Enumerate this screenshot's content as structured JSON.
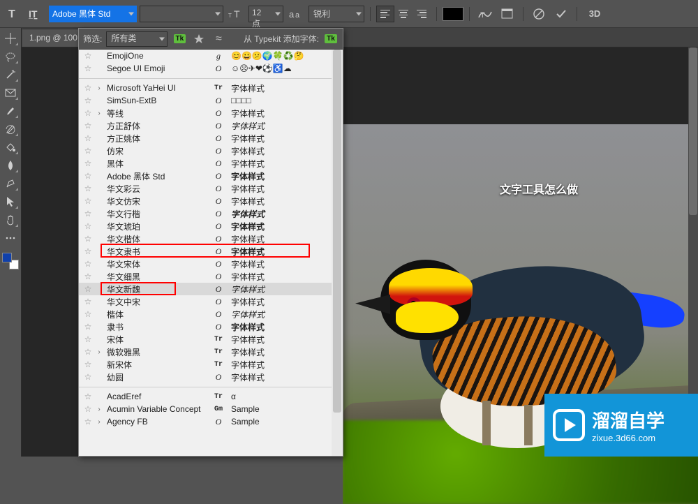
{
  "options": {
    "font_family": "Adobe 黑体 Std",
    "font_weight": "",
    "size_value": "12 点",
    "aa_mode": "锐利"
  },
  "tab": {
    "label": "1.png @ 100"
  },
  "panel": {
    "filter_label": "筛选:",
    "filter_value": "所有类",
    "typekit_label": "从 Typekit 添加字体:"
  },
  "canvas_text": "文字工具怎么做",
  "watermark": {
    "cn": "溜溜自学",
    "url": "zixue.3d66.com"
  },
  "fonts": [
    {
      "star": true,
      "expand": "",
      "name": "EmojiOne",
      "type": "g",
      "sample": "😊😀😕🌍🍀♻️🤔",
      "cls": ""
    },
    {
      "star": true,
      "expand": "",
      "name": "Segoe UI Emoji",
      "type": "O",
      "sample": "☺☹✈❤⚽♿☁",
      "cls": ""
    },
    {
      "divider": true
    },
    {
      "star": true,
      "expand": "›",
      "name": "Microsoft YaHei UI",
      "type": "Tr",
      "sample": "字体样式",
      "cls": ""
    },
    {
      "star": true,
      "expand": "",
      "name": "SimSun-ExtB",
      "type": "O",
      "sample": "□□□□",
      "cls": ""
    },
    {
      "star": true,
      "expand": "›",
      "name": "等线",
      "type": "O",
      "sample": "字体样式",
      "cls": ""
    },
    {
      "star": true,
      "expand": "",
      "name": "方正舒体",
      "type": "O",
      "sample": "字体样式",
      "cls": "ital"
    },
    {
      "star": true,
      "expand": "",
      "name": "方正姚体",
      "type": "O",
      "sample": "字体样式",
      "cls": "serif"
    },
    {
      "star": true,
      "expand": "",
      "name": "仿宋",
      "type": "O",
      "sample": "字体样式",
      "cls": "serif"
    },
    {
      "star": true,
      "expand": "",
      "name": "黑体",
      "type": "O",
      "sample": "字体样式",
      "cls": ""
    },
    {
      "star": true,
      "expand": "",
      "name": "Adobe 黑体 Std",
      "type": "O",
      "sample": "字体样式",
      "cls": "bold"
    },
    {
      "star": true,
      "expand": "",
      "name": "华文彩云",
      "type": "O",
      "sample": "字体样式",
      "cls": ""
    },
    {
      "star": true,
      "expand": "",
      "name": "华文仿宋",
      "type": "O",
      "sample": "字体样式",
      "cls": "serif"
    },
    {
      "star": true,
      "expand": "",
      "name": "华文行楷",
      "type": "O",
      "sample": "字体样式",
      "cls": "ital bold"
    },
    {
      "star": true,
      "expand": "",
      "name": "华文琥珀",
      "type": "O",
      "sample": "字体样式",
      "cls": "bold"
    },
    {
      "star": true,
      "expand": "",
      "name": "华文楷体",
      "type": "O",
      "sample": "字体样式",
      "cls": "serif"
    },
    {
      "star": true,
      "expand": "",
      "name": "华文隶书",
      "type": "O",
      "sample": "字体样式",
      "cls": "bold",
      "red": 1
    },
    {
      "star": true,
      "expand": "",
      "name": "华文宋体",
      "type": "O",
      "sample": "字体样式",
      "cls": "serif"
    },
    {
      "star": true,
      "expand": "",
      "name": "华文细黑",
      "type": "O",
      "sample": "字体样式",
      "cls": ""
    },
    {
      "star": true,
      "expand": "",
      "name": "华文新魏",
      "type": "O",
      "sample": "字体样式",
      "cls": "ital",
      "red": 2,
      "highlight": true
    },
    {
      "star": true,
      "expand": "",
      "name": "华文中宋",
      "type": "O",
      "sample": "字体样式",
      "cls": "serif"
    },
    {
      "star": true,
      "expand": "",
      "name": "楷体",
      "type": "O",
      "sample": "字体样式",
      "cls": "serif ital"
    },
    {
      "star": true,
      "expand": "",
      "name": "隶书",
      "type": "O",
      "sample": "字体样式",
      "cls": "bold"
    },
    {
      "star": true,
      "expand": "",
      "name": "宋体",
      "type": "Tr",
      "sample": "字体样式",
      "cls": "serif"
    },
    {
      "star": true,
      "expand": "›",
      "name": "微软雅黑",
      "type": "Tr",
      "sample": "字体样式",
      "cls": ""
    },
    {
      "star": true,
      "expand": "",
      "name": "新宋体",
      "type": "Tr",
      "sample": "字体样式",
      "cls": "serif"
    },
    {
      "star": true,
      "expand": "",
      "name": "幼圆",
      "type": "O",
      "sample": "字体样式",
      "cls": ""
    },
    {
      "divider": true
    },
    {
      "star": true,
      "expand": "",
      "name": "AcadEref",
      "type": "Tr",
      "sample": "α",
      "cls": ""
    },
    {
      "star": true,
      "expand": "›",
      "name": "Acumin Variable Concept",
      "type": "Gm",
      "sample": "Sample",
      "cls": ""
    },
    {
      "star": true,
      "expand": "›",
      "name": "Agency FB",
      "type": "O",
      "sample": "Sample",
      "cls": ""
    }
  ]
}
